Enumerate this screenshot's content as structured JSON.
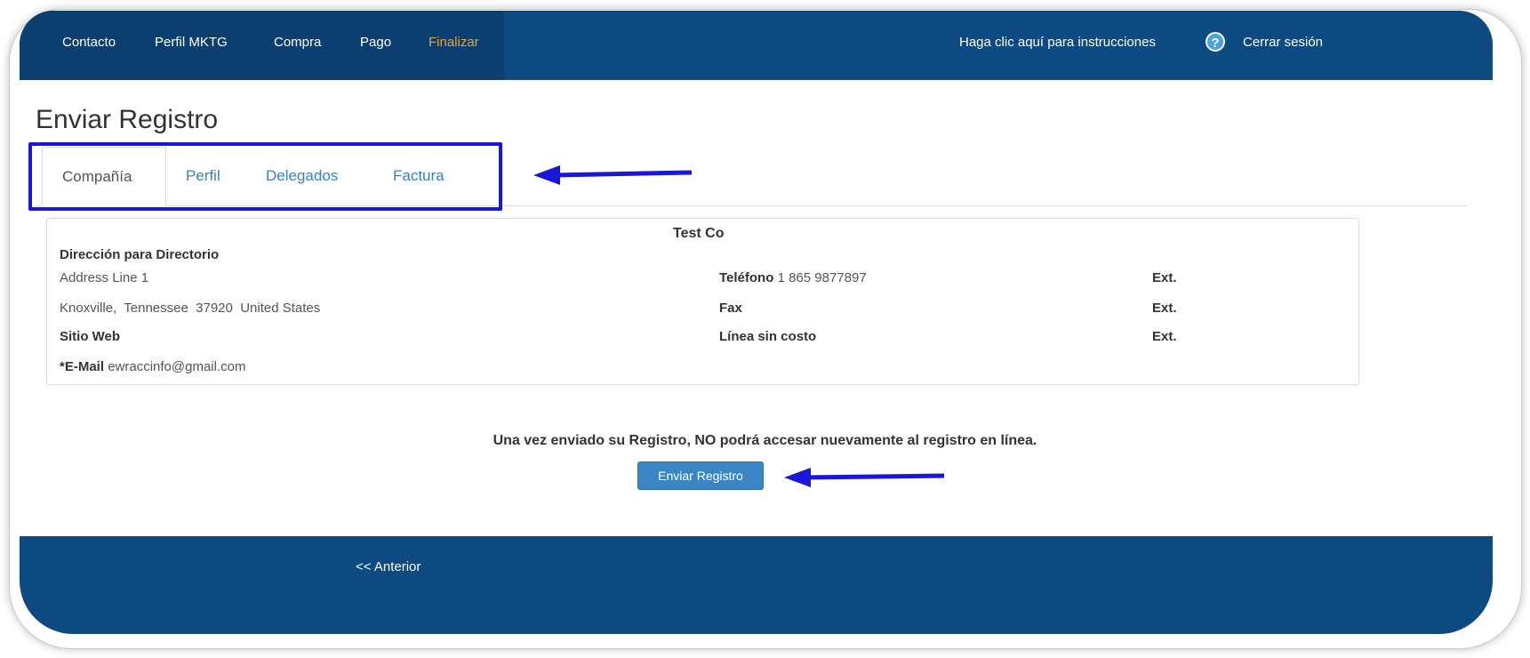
{
  "nav": {
    "items": [
      "Contacto",
      "Perfil MKTG",
      "Compra",
      "Pago",
      "Finalizar"
    ],
    "help_text": "Haga clic aquí para instrucciones",
    "help_icon": "?",
    "logout": "Cerrar sesión"
  },
  "page_title": "Enviar Registro",
  "tabs": [
    "Compañía",
    "Perfil",
    "Delegados",
    "Factura"
  ],
  "company": {
    "name": "Test Co",
    "directory_address_label": "Dirección para Directorio",
    "address_line1": "Address Line 1",
    "city_state_zip": "Knoxville,  Tennessee  37920  United States",
    "website_label": "Sitio Web",
    "email_label": "*E-Mail",
    "email": "ewraccinfo@gmail.com",
    "phone_label": "Teléfono",
    "phone": "1 865 9877897",
    "fax_label": "Fax",
    "tollfree_label": "Línea sin costo",
    "ext_label": "Ext."
  },
  "notice": "Una vez enviado su Registro, NO podrá accesar nuevamente al registro en línea.",
  "submit_label": "Enviar Registro",
  "footer": {
    "previous": "<< Anterior"
  },
  "colors": {
    "nav_bg": "#0d4a82",
    "current_step": "#e8a23a",
    "tab_link": "#3a7fc1",
    "annotation": "#1a16d9",
    "button": "#3a86c4"
  }
}
